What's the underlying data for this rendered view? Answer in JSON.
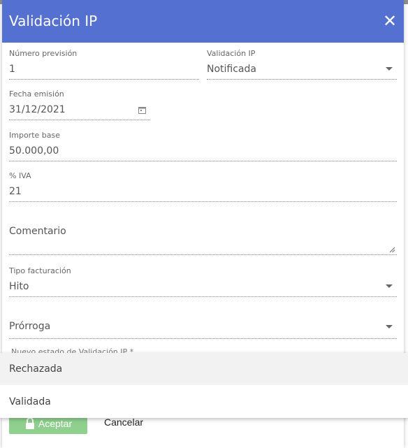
{
  "dialog": {
    "title": "Validación IP",
    "close_icon": "close-icon"
  },
  "fields": {
    "numero_prevision": {
      "label": "Número previsión",
      "value": "1"
    },
    "validacion_ip": {
      "label": "Validación IP",
      "value": "Notificada"
    },
    "fecha_emision": {
      "label": "Fecha emisión",
      "value": "31/12/2021"
    },
    "importe_base": {
      "label": "Importe base",
      "value": "50.000,00"
    },
    "iva": {
      "label": "% IVA",
      "value": "21"
    },
    "comentario": {
      "label": "Comentario",
      "value": ""
    },
    "tipo_facturacion": {
      "label": "Tipo facturación",
      "value": "Hito"
    },
    "prorroga": {
      "label": "Prórroga",
      "value": ""
    },
    "nuevo_estado": {
      "label": "Nuevo estado de Validación IP *"
    }
  },
  "dropdown": {
    "options": [
      "Rechazada",
      "Validada"
    ]
  },
  "footer": {
    "accept_label": "Aceptar",
    "cancel_label": "Cancelar"
  },
  "colors": {
    "header": "#5470d0",
    "accept": "#8fd08f"
  }
}
